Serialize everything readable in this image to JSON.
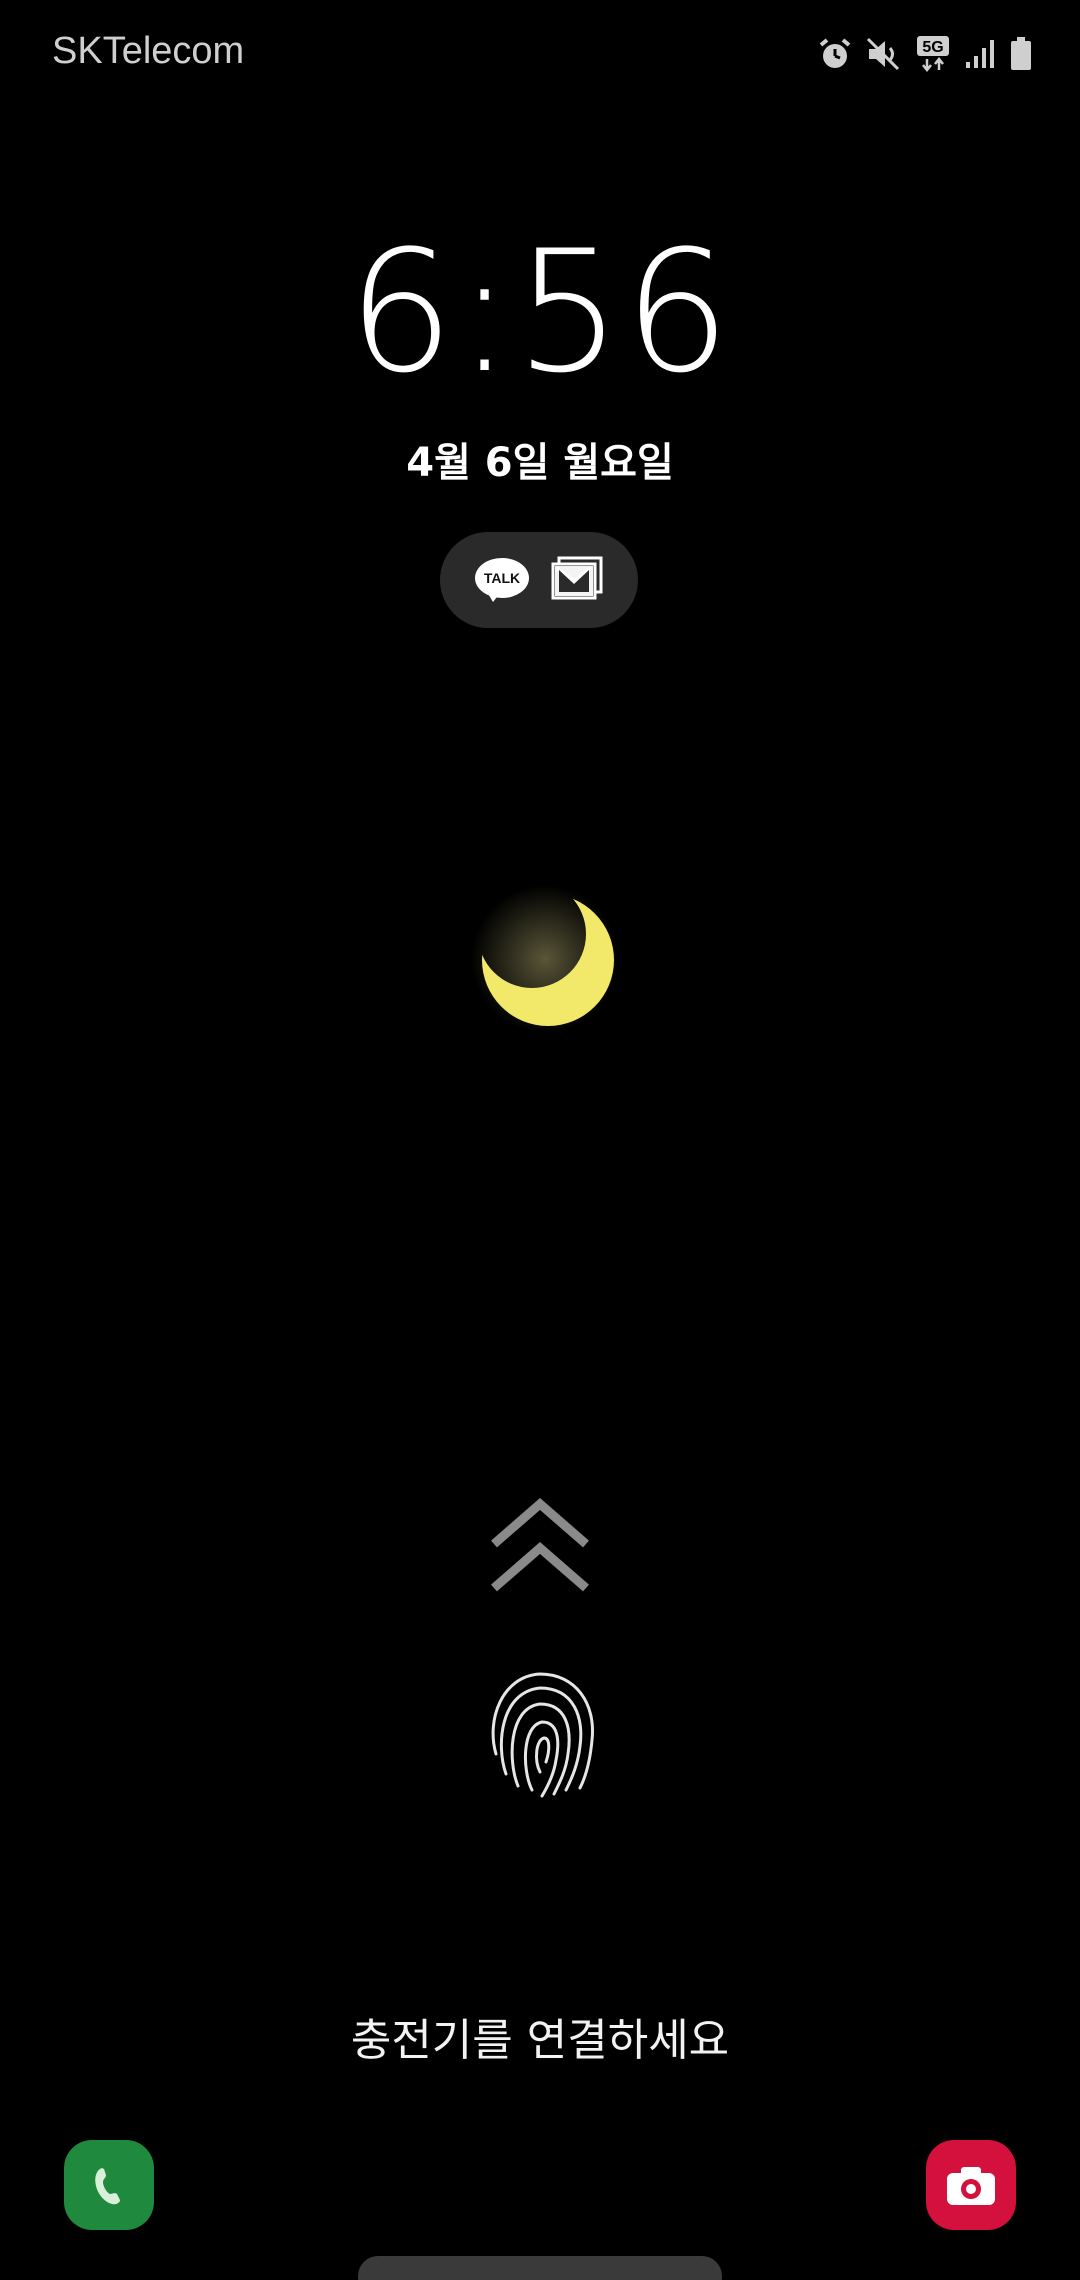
{
  "status_bar": {
    "carrier": "SKTelecom",
    "icons": [
      "alarm-icon",
      "mute-icon",
      "5g-icon",
      "signal-icon",
      "battery-icon"
    ],
    "network_label": "5G"
  },
  "lock_screen": {
    "time": "6:56",
    "date": "4월 6일 월요일",
    "notifications": [
      {
        "app": "kakaotalk-icon",
        "label": "TALK"
      },
      {
        "app": "mail-icon"
      }
    ],
    "charger_message": "충전기를 연결하세요"
  },
  "shortcuts": {
    "left": "phone-icon",
    "right": "camera-icon"
  },
  "colors": {
    "background": "#000000",
    "moon": "#f2e96a",
    "phone_shortcut": "#1f8a3e",
    "camera_shortcut": "#d4103c"
  }
}
